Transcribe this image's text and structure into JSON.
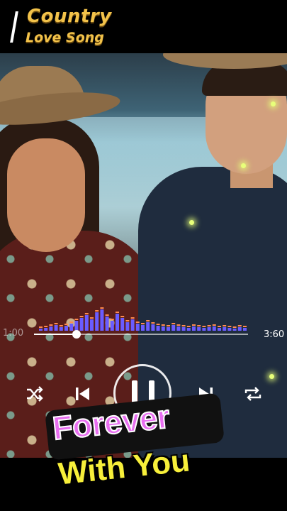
{
  "header": {
    "title_line1": "Country",
    "title_line2": "Love Song"
  },
  "player": {
    "elapsed": "1:00",
    "duration": "3:60",
    "progress_fraction": 0.2,
    "controls": {
      "shuffle_icon": "shuffle-icon",
      "previous_icon": "skip-previous-icon",
      "pause_icon": "pause-icon",
      "next_icon": "skip-next-icon",
      "repeat_icon": "repeat-icon"
    }
  },
  "caption": {
    "line1": "Forever",
    "line2": "With You"
  },
  "colors": {
    "title": "#f2c24a",
    "caption1": "#e86ef0",
    "caption2": "#f7ef3a",
    "viz_blue": "#6a5cff",
    "viz_orange": "#ff8a50"
  }
}
